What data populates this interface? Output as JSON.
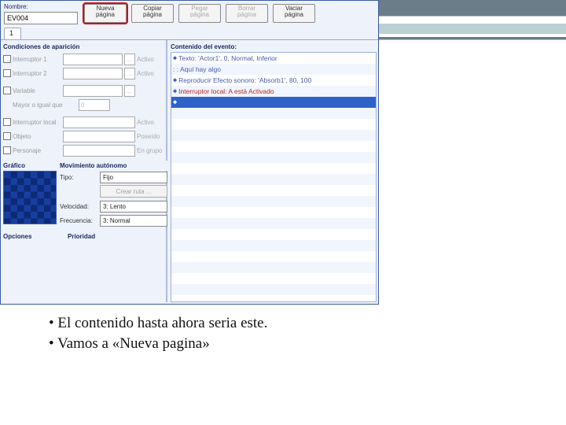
{
  "name_section": {
    "label": "Nombre:",
    "value": "EV004"
  },
  "buttons": {
    "new": {
      "l1": "Nueva",
      "l2": "página"
    },
    "copy": {
      "l1": "Copiar",
      "l2": "página"
    },
    "paste": {
      "l1": "Pegar",
      "l2": "página"
    },
    "del": {
      "l1": "Borrar",
      "l2": "página"
    },
    "clear": {
      "l1": "Vaciar",
      "l2": "página"
    }
  },
  "tab": "1",
  "conditions": {
    "title": "Condiciones de aparición",
    "sw1": {
      "label": "Interruptor 1",
      "side": "Activo",
      "btn": "..."
    },
    "sw2": {
      "label": "Interruptor 2",
      "side": "Activo",
      "btn": "..."
    },
    "var": {
      "label": "Variable",
      "btn": "..."
    },
    "varcmp": {
      "label": "Mayor o igual que",
      "value": "0"
    },
    "swL": {
      "label": "Interruptor local",
      "side": "Activo"
    },
    "item": {
      "label": "Objeto",
      "side": "Poseído"
    },
    "actor": {
      "label": "Personaje",
      "side": "En grupo"
    }
  },
  "graphic": {
    "title": "Gráfico"
  },
  "movement": {
    "title": "Movimiento autónomo",
    "type": {
      "label": "Tipo:",
      "value": "Fijo"
    },
    "route_btn": "Crear ruta ...",
    "speed": {
      "label": "Velocidad:",
      "value": "3: Lento"
    },
    "freq": {
      "label": "Frecuencia:",
      "value": "3: Normal"
    }
  },
  "bottom": {
    "options": "Opciones",
    "priority": "Prioridad"
  },
  "contents": {
    "title": "Contenido del evento:",
    "lines": [
      "Texto: 'Actor1', 0, Normal, Inferior",
      ":       : Aquí hay algo",
      "Reproducir Efecto sonoro: 'Absorb1', 80, 100",
      "Interruptor local: A está Activado"
    ]
  },
  "bullets": {
    "b1": "El contenido hasta ahora seria este.",
    "b2": "Vamos a «Nueva pagina»"
  }
}
